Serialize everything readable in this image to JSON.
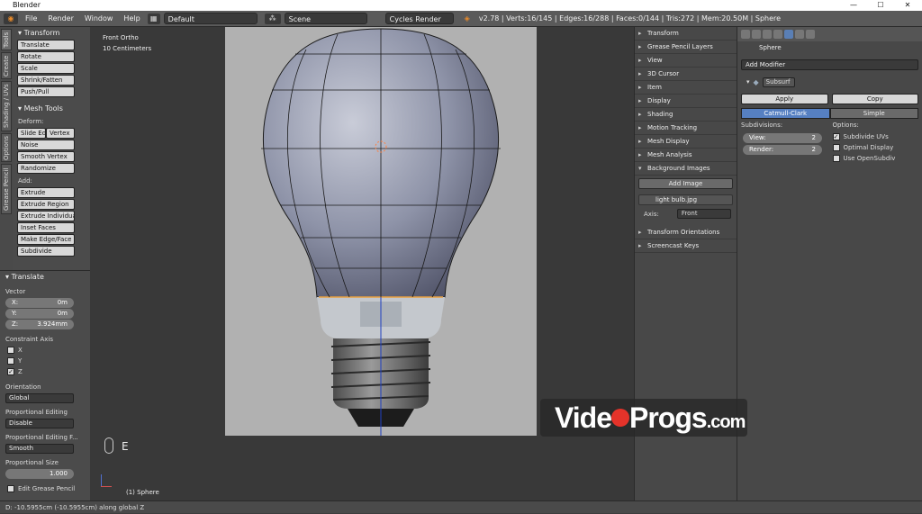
{
  "window": {
    "title": "Blender",
    "controls": [
      "—",
      "☐",
      "✕"
    ]
  },
  "topbar": {
    "menus": [
      "File",
      "Render",
      "Window",
      "Help"
    ],
    "layout": "Default",
    "scene": "Scene",
    "engine": "Cycles Render",
    "stats": "v2.78 | Verts:16/145 | Edges:16/288 | Faces:0/144 | Tris:272 | Mem:20.50M | Sphere"
  },
  "left_tabs": [
    "Tools",
    "Create",
    "Shading / UVs",
    "Options",
    "Grease Pencil"
  ],
  "tools": {
    "transform_header": "Transform",
    "transform_buttons": [
      "Translate",
      "Rotate",
      "Scale",
      "Shrink/Fatten",
      "Push/Pull"
    ],
    "meshtools_header": "Mesh Tools",
    "deform_label": "Deform:",
    "deform_buttons": [
      "Slide Ed",
      "Vertex",
      "Noise",
      "Smooth Vertex",
      "Randomize"
    ],
    "add_label": "Add:",
    "extrude": "Extrude",
    "add_buttons": [
      "Extrude Region",
      "Extrude Individual",
      "Inset Faces",
      "Make Edge/Face",
      "Subdivide"
    ]
  },
  "operator": {
    "header": "Translate",
    "vector_label": "Vector",
    "x": {
      "label": "X:",
      "value": "0m"
    },
    "y": {
      "label": "Y:",
      "value": "0m"
    },
    "z": {
      "label": "Z:",
      "value": "3.924mm"
    },
    "constraint_label": "Constraint Axis",
    "axes": [
      {
        "name": "X",
        "checked": false
      },
      {
        "name": "Y",
        "checked": false
      },
      {
        "name": "Z",
        "checked": true
      }
    ],
    "orientation_label": "Orientation",
    "orientation": "Global",
    "prop_edit_label": "Proportional Editing",
    "prop_edit": "Disable",
    "prop_falloff_label": "Proportional Editing F...",
    "prop_falloff": "Smooth",
    "prop_size_label": "Proportional Size",
    "prop_size": "1.000",
    "edit_gp": "Edit Grease Pencil"
  },
  "viewport": {
    "view_name": "Front Ortho",
    "scale": "10 Centimeters",
    "key_hint": "E",
    "object_label": "(1) Sphere"
  },
  "npanel": {
    "rows": [
      "Transform",
      "Grease Pencil Layers",
      "View",
      "3D Cursor",
      "Item",
      "Display",
      "Shading",
      "Motion Tracking",
      "Mesh Display",
      "Mesh Analysis",
      "Background Images"
    ],
    "add_image": "Add Image",
    "image_name": "light bulb.jpg",
    "axis_label": "Axis:",
    "axis_value": "Front",
    "rows2": [
      "Transform Orientations",
      "Screencast Keys"
    ]
  },
  "props": {
    "object_name": "Sphere",
    "add_modifier": "Add Modifier",
    "modifier_name": "Subsurf",
    "apply": "Apply",
    "copy": "Copy",
    "catmull": "Catmull-Clark",
    "simple": "Simple",
    "subdivisions_label": "Subdivisions:",
    "view_label": "View:",
    "view_value": "2",
    "render_label": "Render:",
    "render_value": "2",
    "options_label": "Options:",
    "subdivide_uvs": "Subdivide UVs",
    "optimal_display": "Optimal Display",
    "use_opensubdiv": "Use OpenSubdiv"
  },
  "status": {
    "text": "D: -10.5955cm (-10.5955cm) along global Z"
  },
  "watermark": {
    "left": "Vide",
    "right": "Progs",
    "suffix": ".com"
  }
}
